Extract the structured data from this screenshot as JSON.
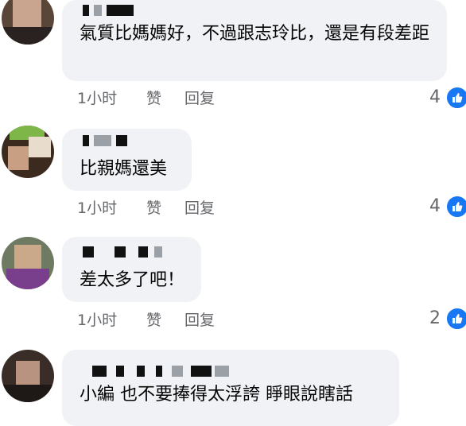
{
  "comments": [
    {
      "text": "氣質比媽媽好，不過跟志玲比，還是有段差距",
      "time": "1小时",
      "like_label": "赞",
      "reply_label": "回复",
      "reactions": "4"
    },
    {
      "text": "比親媽還美",
      "time": "1小时",
      "like_label": "赞",
      "reply_label": "回复",
      "reactions": "4"
    },
    {
      "text": "差太多了吧！",
      "time": "1小时",
      "like_label": "赞",
      "reply_label": "回复",
      "reactions": "2"
    },
    {
      "text": "小編 也不要捧得太浮誇 睜眼說瞎話"
    }
  ],
  "colors": {
    "bubble": "#f0f2f5",
    "like_blue": "#1877f2",
    "meta_gray": "#65676b"
  }
}
